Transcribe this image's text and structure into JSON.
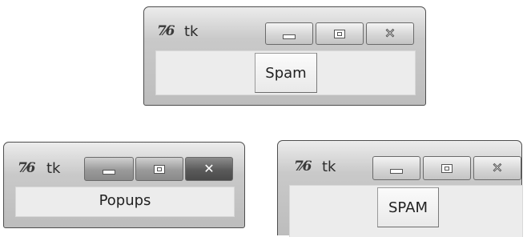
{
  "windows": {
    "spam_window": {
      "icon_glyph": "7⁄6",
      "title": "tk",
      "button_label": "Spam"
    },
    "popups_window": {
      "icon_glyph": "7⁄6",
      "title": "tk",
      "label_text": "Popups"
    },
    "spam_upper_window": {
      "icon_glyph": "7⁄6",
      "title": "tk",
      "button_label": "SPAM"
    }
  },
  "controls": {
    "minimize_icon": "minimize-icon",
    "maximize_icon": "maximize-icon",
    "close_glyph": "✕"
  }
}
